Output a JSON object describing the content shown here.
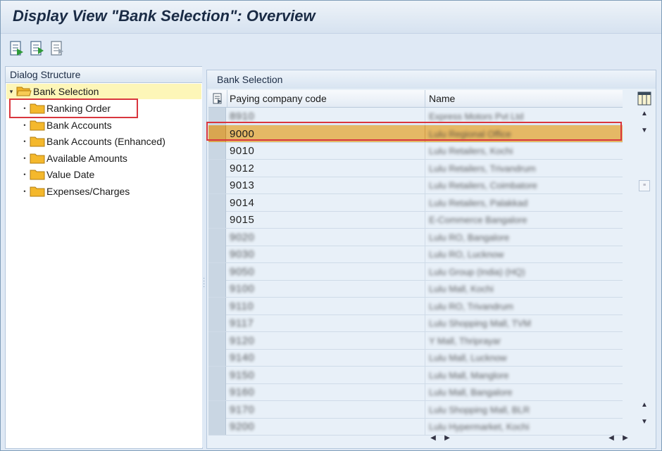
{
  "window": {
    "title": "Display View \"Bank Selection\": Overview"
  },
  "toolbar": {
    "buttons": [
      "details-icon",
      "export-icon",
      "print-icon"
    ]
  },
  "dialog_structure": {
    "header": "Dialog Structure",
    "root": "Bank Selection",
    "items": [
      "Ranking Order",
      "Bank Accounts",
      "Bank Accounts (Enhanced)",
      "Available Amounts",
      "Value Date",
      "Expenses/Charges"
    ]
  },
  "table": {
    "title": "Bank Selection",
    "columns": [
      "Paying company code",
      "Name"
    ],
    "rows": [
      {
        "code": "8910",
        "name": "Express Motors Pvt Ltd"
      },
      {
        "code": "9000",
        "name": "Lulu Regional Office"
      },
      {
        "code": "9010",
        "name": "Lulu Retailers, Kochi"
      },
      {
        "code": "9012",
        "name": "Lulu Retailers, Trivandrum"
      },
      {
        "code": "9013",
        "name": "Lulu Retailers, Coimbatore"
      },
      {
        "code": "9014",
        "name": "Lulu Retailers, Palakkad"
      },
      {
        "code": "9015",
        "name": "E-Commerce Bangalore"
      },
      {
        "code": "9020",
        "name": "Lulu RO, Bangalore"
      },
      {
        "code": "9030",
        "name": "Lulu RO, Lucknow"
      },
      {
        "code": "9050",
        "name": "Lulu Group (India) (HQ)"
      },
      {
        "code": "9100",
        "name": "Lulu Mall, Kochi"
      },
      {
        "code": "9110",
        "name": "Lulu RO, Trivandrum"
      },
      {
        "code": "9117",
        "name": "Lulu Shopping Mall, TVM"
      },
      {
        "code": "9120",
        "name": "Y Mall, Thriprayar"
      },
      {
        "code": "9140",
        "name": "Lulu Mall, Lucknow"
      },
      {
        "code": "9150",
        "name": "Lulu Mall, Manglore"
      },
      {
        "code": "9160",
        "name": "Lulu Mall, Bangalore"
      },
      {
        "code": "9170",
        "name": "Lulu Shopping Mall, BLR"
      },
      {
        "code": "9200",
        "name": "Lulu Hypermarket, Kochi"
      }
    ],
    "selected_index": 1,
    "blurred": true
  },
  "colors": {
    "selected_row": "#e5b865",
    "highlight_box": "#d9363e",
    "tree_highlight": "#fdf6b8"
  }
}
